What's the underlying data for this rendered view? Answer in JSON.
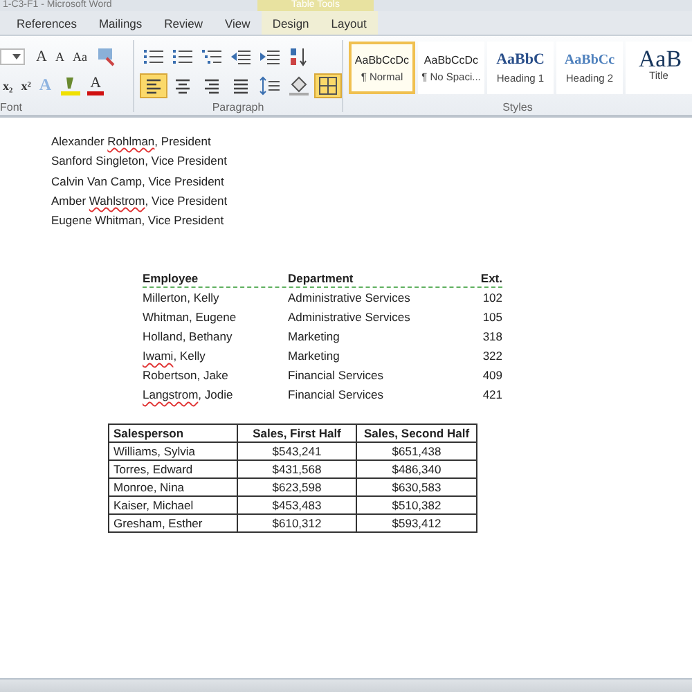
{
  "window": {
    "title": "1-C3-F1 - Microsoft Word"
  },
  "contextual_group": {
    "label": "Table Tools"
  },
  "tabs": [
    {
      "label": "References",
      "contextual": false
    },
    {
      "label": "Mailings",
      "contextual": false
    },
    {
      "label": "Review",
      "contextual": false
    },
    {
      "label": "View",
      "contextual": false
    },
    {
      "label": "Design",
      "contextual": true
    },
    {
      "label": "Layout",
      "contextual": true
    }
  ],
  "font_group": {
    "label": "Font",
    "row1": [
      {
        "kind": "size_box"
      },
      {
        "kind": "grow",
        "text": "A"
      },
      {
        "kind": "shrink",
        "text": "A"
      },
      {
        "kind": "case",
        "text": "Aa"
      },
      {
        "kind": "clear"
      }
    ],
    "row2": [
      {
        "kind": "subscript",
        "text": "x₂"
      },
      {
        "kind": "superscript",
        "text": "x²"
      },
      {
        "kind": "effects",
        "text": "A"
      },
      {
        "kind": "highlight"
      },
      {
        "kind": "font_color",
        "text": "A"
      }
    ]
  },
  "paragraph_group": {
    "label": "Paragraph",
    "row1": [
      {
        "kind": "bullets",
        "selected": false
      },
      {
        "kind": "numbering",
        "selected": false
      },
      {
        "kind": "multilevel",
        "selected": false
      },
      {
        "kind": "outdent",
        "selected": false
      },
      {
        "kind": "indent",
        "selected": false
      },
      {
        "kind": "sort",
        "selected": false
      }
    ],
    "row2": [
      {
        "kind": "align_left",
        "selected": true
      },
      {
        "kind": "center",
        "selected": false
      },
      {
        "kind": "align_right",
        "selected": false
      },
      {
        "kind": "justify",
        "selected": false
      },
      {
        "kind": "line_spacing",
        "selected": false
      },
      {
        "kind": "shading",
        "selected": false
      },
      {
        "kind": "borders",
        "selected": true
      }
    ]
  },
  "styles_group": {
    "label": "Styles",
    "styles": [
      {
        "preview": "AaBbCcDc",
        "label": "¶ Normal",
        "kind": "normal",
        "selected": true
      },
      {
        "preview": "AaBbCcDc",
        "label": "¶ No Spaci...",
        "kind": "normal",
        "selected": false
      },
      {
        "preview": "AaBbC",
        "label": "Heading 1",
        "kind": "heading1",
        "selected": false
      },
      {
        "preview": "AaBbCc",
        "label": "Heading 2",
        "kind": "heading2",
        "selected": false
      },
      {
        "preview": "AaB",
        "label": "Title",
        "kind": "title",
        "selected": false
      }
    ]
  },
  "officers": [
    [
      {
        "text": "Alexander ",
        "misspelled": false
      },
      {
        "text": "Rohlman",
        "misspelled": true
      },
      {
        "text": ", President",
        "misspelled": false
      }
    ],
    [
      {
        "text": "Sanford Singleton, Vice President",
        "misspelled": false
      }
    ],
    [
      {
        "text": "Calvin Van Camp, Vice President",
        "misspelled": false
      }
    ],
    [
      {
        "text": "Amber ",
        "misspelled": false
      },
      {
        "text": "Wahlstrom",
        "misspelled": true
      },
      {
        "text": ", Vice President",
        "misspelled": false
      }
    ],
    [
      {
        "text": "Eugene Whitman, Vice President",
        "misspelled": false
      }
    ]
  ],
  "employee_table": {
    "grammar_flag": true,
    "columns": [
      "Employee",
      "Department",
      "Ext."
    ],
    "rows": [
      [
        [
          {
            "text": "Millerton, Kelly",
            "misspelled": false
          }
        ],
        "Administrative Services",
        "102"
      ],
      [
        [
          {
            "text": "Whitman, Eugene",
            "misspelled": false
          }
        ],
        "Administrative Services",
        "105"
      ],
      [
        [
          {
            "text": "Holland, Bethany",
            "misspelled": false
          }
        ],
        "Marketing",
        "318"
      ],
      [
        [
          {
            "text": "Iwami",
            "misspelled": true
          },
          {
            "text": ", Kelly",
            "misspelled": false
          }
        ],
        "Marketing",
        "322"
      ],
      [
        [
          {
            "text": "Robertson, Jake",
            "misspelled": false
          }
        ],
        "Financial Services",
        "409"
      ],
      [
        [
          {
            "text": "Langstrom",
            "misspelled": true
          },
          {
            "text": ", Jodie",
            "misspelled": false
          }
        ],
        "Financial Services",
        "421"
      ]
    ]
  },
  "sales_table": {
    "columns": [
      "Salesperson",
      "Sales, First Half",
      "Sales, Second Half"
    ],
    "rows": [
      [
        "Williams, Sylvia",
        "$543,241",
        "$651,438"
      ],
      [
        "Torres, Edward",
        "$431,568",
        "$486,340"
      ],
      [
        "Monroe, Nina",
        "$623,598",
        "$630,583"
      ],
      [
        "Kaiser, Michael",
        "$453,483",
        "$510,382"
      ],
      [
        "Gresham, Esther",
        "$610,312",
        "$593,412"
      ]
    ]
  }
}
